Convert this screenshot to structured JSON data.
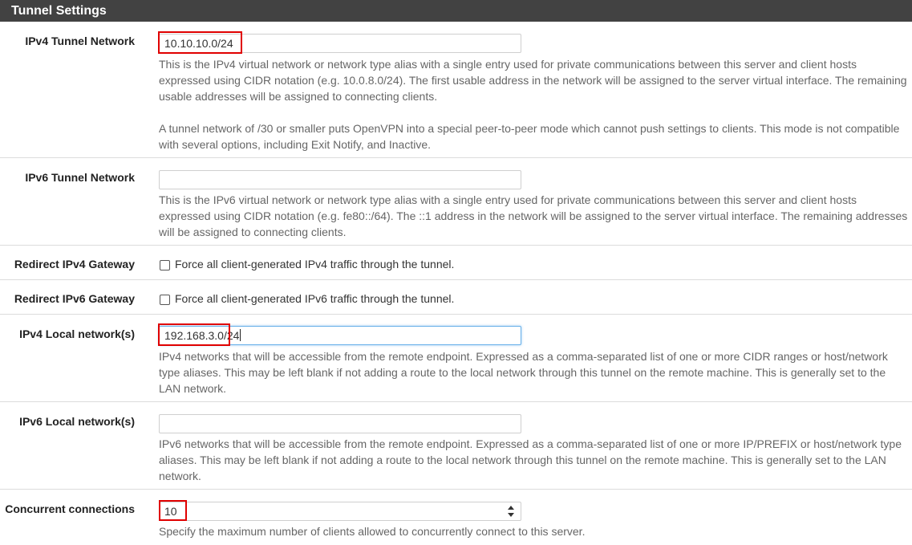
{
  "section": {
    "title": "Tunnel Settings"
  },
  "rows": {
    "ipv4_tunnel": {
      "label": "IPv4 Tunnel Network",
      "value": "10.10.10.0/24",
      "help1": "This is the IPv4 virtual network or network type alias with a single entry used for private communications between this server and client hosts expressed using CIDR notation (e.g. 10.0.8.0/24). The first usable address in the network will be assigned to the server virtual interface. The remaining usable addresses will be assigned to connecting clients.",
      "help2": "A tunnel network of /30 or smaller puts OpenVPN into a special peer-to-peer mode which cannot push settings to clients. This mode is not compatible with several options, including Exit Notify, and Inactive."
    },
    "ipv6_tunnel": {
      "label": "IPv6 Tunnel Network",
      "value": "",
      "help": "This is the IPv6 virtual network or network type alias with a single entry used for private communications between this server and client hosts expressed using CIDR notation (e.g. fe80::/64). The ::1 address in the network will be assigned to the server virtual interface. The remaining addresses will be assigned to connecting clients."
    },
    "redirect_ipv4": {
      "label": "Redirect IPv4 Gateway",
      "checkbox_text": "Force all client-generated IPv4 traffic through the tunnel.",
      "checked": false
    },
    "redirect_ipv6": {
      "label": "Redirect IPv6 Gateway",
      "checkbox_text": "Force all client-generated IPv6 traffic through the tunnel.",
      "checked": false
    },
    "ipv4_local": {
      "label": "IPv4 Local network(s)",
      "value": "192.168.3.0/24",
      "help": "IPv4 networks that will be accessible from the remote endpoint. Expressed as a comma-separated list of one or more CIDR ranges or host/network type aliases. This may be left blank if not adding a route to the local network through this tunnel on the remote machine. This is generally set to the LAN network."
    },
    "ipv6_local": {
      "label": "IPv6 Local network(s)",
      "value": "",
      "help": "IPv6 networks that will be accessible from the remote endpoint. Expressed as a comma-separated list of one or more IP/PREFIX or host/network type aliases. This may be left blank if not adding a route to the local network through this tunnel on the remote machine. This is generally set to the LAN network."
    },
    "concurrent": {
      "label": "Concurrent connections",
      "value": "10",
      "help": "Specify the maximum number of clients allowed to concurrently connect to this server."
    }
  },
  "colors": {
    "header_bg": "#424242",
    "highlight": "#e00000",
    "focus": "#66afe9"
  },
  "icons": {
    "spinner": "up-down-spinner-icon"
  }
}
